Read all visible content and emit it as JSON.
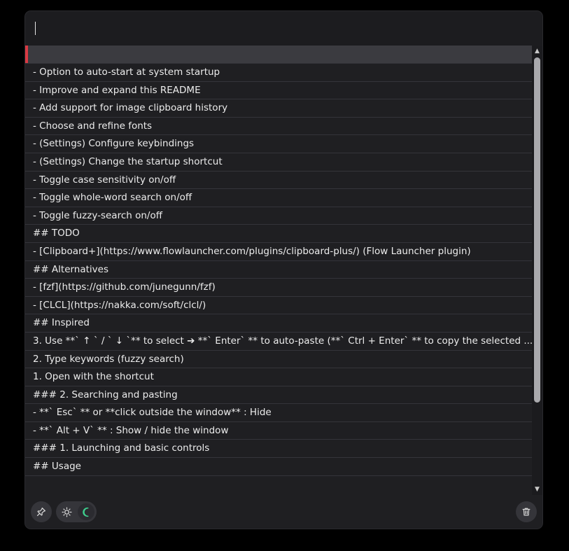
{
  "search": {
    "value": ""
  },
  "clips": [
    "",
    "- Option to auto-start at system startup",
    "- Improve and expand this README",
    "- Add support for image clipboard history",
    "- Choose and refine fonts",
    "- (Settings) Configure keybindings",
    "- (Settings) Change the startup shortcut",
    "- Toggle case sensitivity on/off",
    "- Toggle whole-word search on/off",
    "- Toggle fuzzy-search on/off",
    "## TODO",
    "- [Clipboard+](https://www.flowlauncher.com/plugins/clipboard-plus/) (Flow Launcher plugin)",
    "## Alternatives",
    "- [fzf](https://github.com/junegunn/fzf)",
    "- [CLCL](https://nakka.com/soft/clcl/)",
    "## Inspired",
    "3. Use **` ↑ ` / ` ↓ `** to select ➔ **` Enter` ** to auto-paste (**` Ctrl + Enter` ** to copy the selected ...",
    "2. Type keywords (fuzzy search)",
    "1. Open with the shortcut",
    "### 2. Searching and pasting",
    "- **` Esc` ** or **click outside the window** : Hide",
    "- **` Alt + V` ** : Show / hide the window",
    "### 1. Launching and basic controls",
    "## Usage"
  ],
  "icons": {
    "pin": "pin-icon",
    "light": "sun-icon",
    "dark": "moon-icon",
    "trash": "trash-icon",
    "scroll_up": "▲",
    "scroll_down": "▼"
  },
  "colors": {
    "selected_accent": "#d93a43",
    "moon": "#3ecf8e"
  }
}
